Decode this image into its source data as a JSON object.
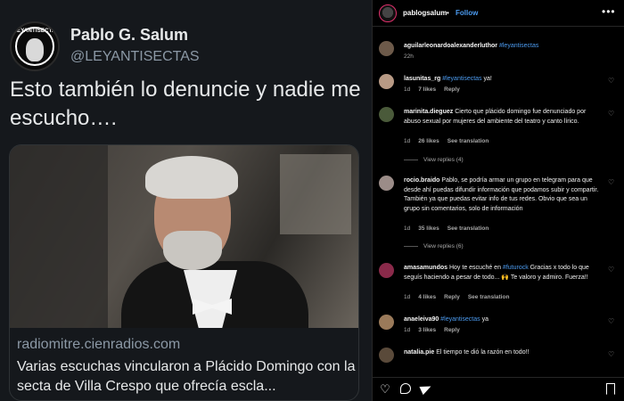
{
  "tweet": {
    "avatar_logo_text": "LEYANTISECTAS",
    "display_name": "Pablo G. Salum",
    "handle": "@LEYANTISECTAS",
    "text": "Esto también lo denuncie y nadie me escucho….",
    "card": {
      "domain": "radiomitre.cienradios.com",
      "headline": "Varias escuchas vincularon a Plácido Domingo con la secta de Villa Crespo que ofrecía escla..."
    }
  },
  "instagram": {
    "header": {
      "username": "pablogsalum",
      "dot": "•",
      "follow_label": "Follow",
      "more_icon": "more-horizontal-icon"
    },
    "comments": [
      {
        "username": "aguilarleonardoalexanderluthor",
        "text": "",
        "tag": "#leyantisectas",
        "time": "22h",
        "likes": "",
        "reply": "",
        "translation": "",
        "avatar_color": "#6d5a4a"
      },
      {
        "username": "lasunitas_rg",
        "text": "ya!",
        "tag": "#leyantisectas",
        "time": "1d",
        "likes": "7 likes",
        "reply": "Reply",
        "translation": "",
        "avatar_color": "#b89a85"
      },
      {
        "username": "marinita.dieguez",
        "text": "Cierto que plácido domingo fue denunciado por abuso sexual por mujeres del ambiente del teatro y canto lírico.",
        "tag": "",
        "time": "1d",
        "likes": "26 likes",
        "reply": "Reply",
        "translation": "See translation",
        "avatar_color": "#4a5a3a",
        "view_replies": "View replies (4)"
      },
      {
        "username": "rocio.braido",
        "text": "Pablo, se podría armar un grupo en telegram para que desde ahí puedas difundir información que podamos subir y compartir. También ya que puedas evitar info de tus redes. Obvio que sea un grupo sin comentarios, solo de información",
        "tag": "",
        "time": "1d",
        "likes": "35 likes",
        "reply": "Reply",
        "translation": "See translation",
        "avatar_color": "#9b8c88",
        "view_replies": "View replies (6)"
      },
      {
        "username": "amasamundos",
        "text_before": "Hoy te escuché en",
        "tag": "#futurock",
        "text": "Gracias x todo lo que seguís haciendo a pesar de todo... 🙌 Te valoro y admiro. Fuerza!!",
        "time": "1d",
        "likes": "4 likes",
        "reply": "Reply",
        "translation": "See translation",
        "avatar_color": "#8a2a4a"
      },
      {
        "username": "anaeleiva90",
        "text": "ya",
        "tag": "#leyantisectas",
        "time": "1d",
        "likes": "3 likes",
        "reply": "Reply",
        "translation": "",
        "avatar_color": "#9a7a5a"
      },
      {
        "username": "natalia.pie",
        "text": "El tiempo te dió la razón en todo!!",
        "tag": "",
        "time": "",
        "likes": "",
        "reply": "",
        "translation": "",
        "avatar_color": "#5a4a3a"
      }
    ],
    "actions": {
      "like_icon": "heart-outline-icon",
      "comment_icon": "comment-icon",
      "share_icon": "send-icon",
      "save_icon": "bookmark-icon"
    }
  }
}
